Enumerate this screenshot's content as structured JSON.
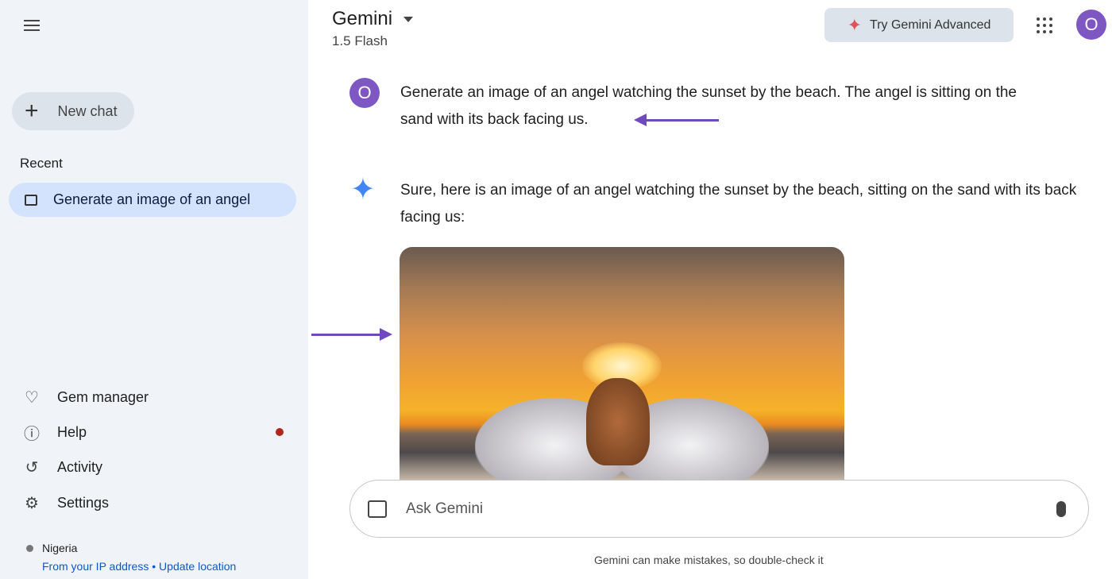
{
  "sidebar": {
    "new_chat": "New chat",
    "recent_heading": "Recent",
    "recent_items": [
      {
        "label": "Generate an image of an angel"
      }
    ],
    "nav": [
      {
        "label": "Gem manager",
        "icon": "gem-icon"
      },
      {
        "label": "Help",
        "icon": "help-icon",
        "has_notification": true
      },
      {
        "label": "Activity",
        "icon": "history-icon"
      },
      {
        "label": "Settings",
        "icon": "gear-icon"
      }
    ],
    "location": {
      "country": "Nigeria",
      "source": "From your IP address",
      "separator": "•",
      "update": "Update location"
    }
  },
  "header": {
    "title": "Gemini",
    "model": "1.5 Flash",
    "advanced_button": "Try Gemini Advanced",
    "avatar_initial": "O"
  },
  "chat": {
    "user_message": "Generate an image of an angel watching the sunset by the beach. The angel is sitting on the sand with its back facing us.",
    "response_text": "Sure, here is an image of an angel watching the sunset by the beach, sitting on the sand with its back facing us:"
  },
  "input": {
    "placeholder": "Ask Gemini",
    "value": ""
  },
  "disclaimer": "Gemini can make mistakes, so double-check it",
  "colors": {
    "sidebar_bg": "#f0f4f9",
    "accent_purple": "#7048c0",
    "avatar": "#7e57c2",
    "link": "#0b57d0",
    "selected": "#d3e3fd"
  }
}
